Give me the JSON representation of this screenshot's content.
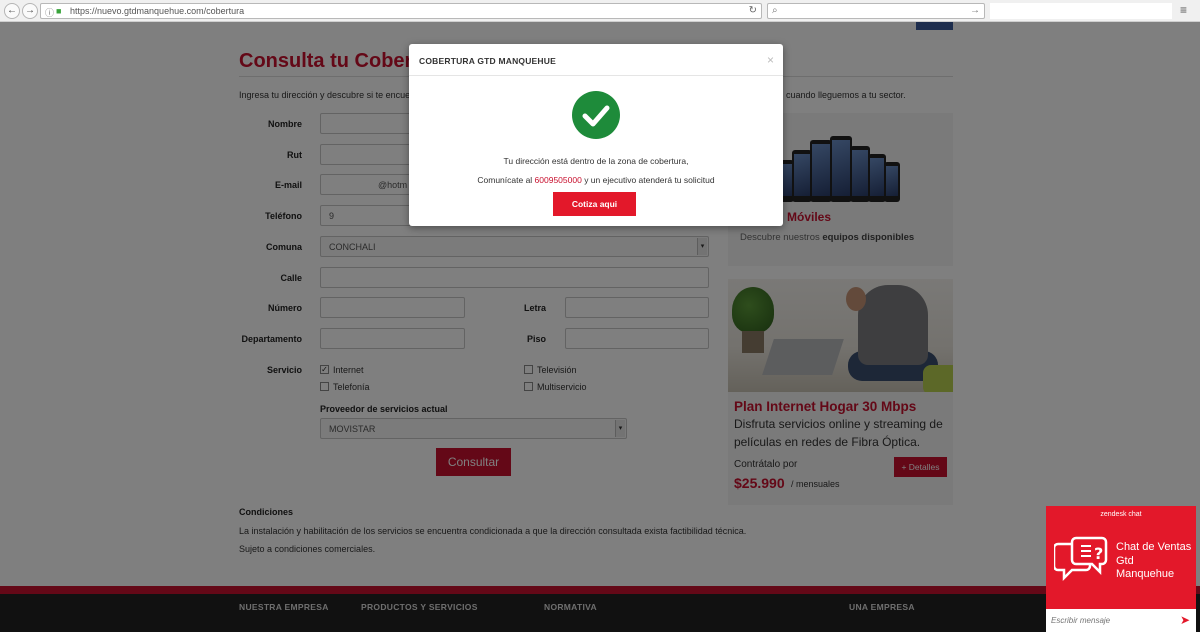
{
  "browser": {
    "url": "https://nuevo.gtdmanquehue.com/cobertura",
    "back_icon": "arrow-left-icon",
    "forward_icon": "arrow-right-icon",
    "info_icon": "info-icon",
    "lock_icon": "lock-icon",
    "reload_icon": "reload-icon",
    "search_icon": "search-icon",
    "go_icon": "arrow-right-icon",
    "menu_icon": "menu-icon"
  },
  "page": {
    "title": "Consulta tu Cobertura",
    "intro": "Ingresa tu dirección y descubre si te encuentra",
    "intro_tail": "cuando lleguemos a tu sector.",
    "form": {
      "labels": {
        "nombre": "Nombre",
        "rut": "Rut",
        "email": "E-mail",
        "telefono": "Teléfono",
        "comuna": "Comuna",
        "calle": "Calle",
        "numero": "Número",
        "letra": "Letra",
        "departamento": "Departamento",
        "piso": "Piso",
        "servicio": "Servicio"
      },
      "email_suffix": "@hotm",
      "telefono_prefix": "9",
      "comuna_value": "CONCHALI",
      "services": [
        {
          "label": "Internet",
          "checked": true
        },
        {
          "label": "Telefonía",
          "checked": false
        },
        {
          "label": "Televisión",
          "checked": false
        },
        {
          "label": "Multiservicio",
          "checked": false
        }
      ],
      "provider_label": "Proveedor de servicios actual",
      "provider_value": "MOVISTAR",
      "submit_label": "Consultar"
    },
    "conditions": {
      "title": "Condiciones",
      "line1": "La instalación y habilitación de los servicios se encuentra condicionada a que la dirección consultada exista factibilidad técnica.",
      "line2": "Sujeto a condiciones comerciales."
    },
    "sidebar": {
      "moviles_title": "Móviles",
      "moviles_sub_prefix": "Descubre nuestros ",
      "moviles_sub_bold": "equipos disponibles",
      "plan_title": "Plan Internet Hogar 30 Mbps",
      "plan_desc_1": "Disfruta servicios online y streaming de",
      "plan_desc_2": "películas en redes de Fibra Óptica.",
      "contratalo": "Contrátalo por",
      "details_button": "+ Detalles",
      "price": "$25.990",
      "per": "/ mensuales"
    },
    "footer": {
      "links": [
        "NUESTRA EMPRESA",
        "PRODUCTOS Y SERVICIOS",
        "NORMATIVA",
        "UNA EMPRESA"
      ]
    }
  },
  "modal": {
    "title": "COBERTURA GTD MANQUEHUE",
    "close": "×",
    "message_1": "Tu dirección está dentro de la zona de cobertura,",
    "message_2_prefix": "Comunícate al ",
    "phone": "6009505000",
    "message_2_suffix": " y un ejecutivo atenderá tu solicitud",
    "cta": "Cotiza aqui"
  },
  "chat": {
    "brand": "zendesk chat",
    "title": "Chat de Ventas Gtd Manquehue",
    "placeholder": "Escribir mensaje",
    "send_icon": "send-icon"
  },
  "colors": {
    "brand_red": "#c8102e",
    "success_green": "#1e8b3a",
    "footer_dark": "#232323"
  }
}
